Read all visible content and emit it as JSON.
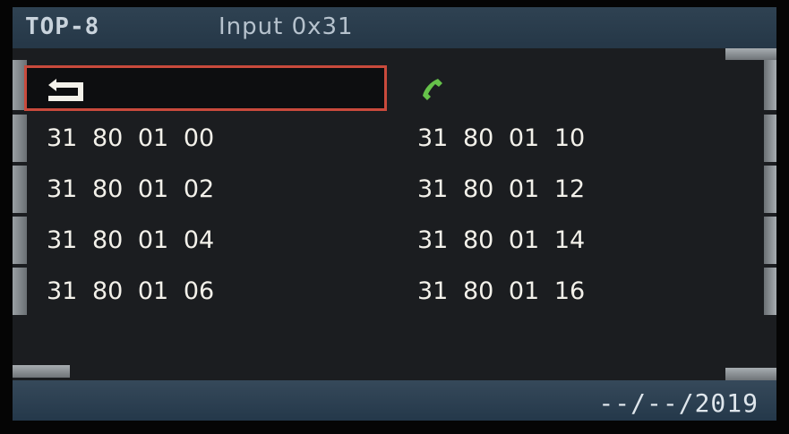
{
  "header": {
    "title": "TOP-8",
    "input_label": "Input 0x31"
  },
  "controls": {
    "back_icon": "back-return-icon",
    "phone_icon": "phone-icon",
    "accent_color": "#c94a3c",
    "phone_color": "#66c24a"
  },
  "list": {
    "left": [
      "31 80 01 00",
      "31 80 01 02",
      "31 80 01 04",
      "31 80 01 06"
    ],
    "right": [
      "31 80 01 10",
      "31 80 01 12",
      "31 80 01 14",
      "31 80 01 16"
    ]
  },
  "footer": {
    "date": "--/--/2019"
  }
}
